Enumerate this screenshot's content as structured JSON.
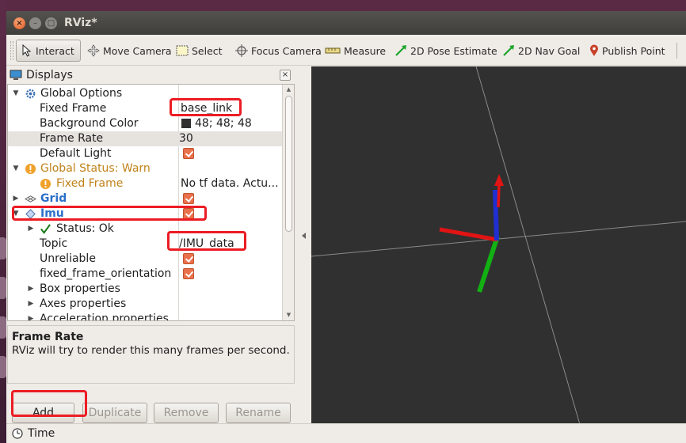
{
  "window": {
    "title": "RViz*"
  },
  "toolbar": {
    "tools": [
      {
        "label": "Interact",
        "icon": "cursor-icon"
      },
      {
        "label": "Move Camera",
        "icon": "move-camera-icon"
      },
      {
        "label": "Select",
        "icon": "select-box-icon"
      },
      {
        "label": "Focus Camera",
        "icon": "focus-crosshair-icon"
      },
      {
        "label": "Measure",
        "icon": "ruler-icon"
      },
      {
        "label": "2D Pose Estimate",
        "icon": "green-arrow-icon"
      },
      {
        "label": "2D Nav Goal",
        "icon": "green-arrow-icon"
      },
      {
        "label": "Publish Point",
        "icon": "map-pin-icon"
      }
    ]
  },
  "displays": {
    "title": "Displays",
    "close_label": "×",
    "rows": [
      {
        "name": "Global Options",
        "value": ""
      },
      {
        "name": "Fixed Frame",
        "value": "base_link"
      },
      {
        "name": "Background Color",
        "value": "48; 48; 48"
      },
      {
        "name": "Frame Rate",
        "value": "30"
      },
      {
        "name": "Default Light",
        "value": ""
      },
      {
        "name": "Global Status: Warn",
        "value": ""
      },
      {
        "name": "Fixed Frame",
        "value": "No tf data.  Actu..."
      },
      {
        "name": "Grid",
        "value": ""
      },
      {
        "name": "Imu",
        "value": ""
      },
      {
        "name": "Status: Ok",
        "value": ""
      },
      {
        "name": "Topic",
        "value": "/IMU_data"
      },
      {
        "name": "Unreliable",
        "value": ""
      },
      {
        "name": "fixed_frame_orientation",
        "value": ""
      },
      {
        "name": "Box properties",
        "value": ""
      },
      {
        "name": "Axes properties",
        "value": ""
      },
      {
        "name": "Acceleration properties",
        "value": ""
      }
    ],
    "description": {
      "title": "Frame Rate",
      "text": "RViz will try to render this many frames per second."
    },
    "buttons": {
      "add": "Add",
      "duplicate": "Duplicate",
      "remove": "Remove",
      "rename": "Rename"
    }
  },
  "colors": {
    "background_swatch": "#303030",
    "checkbox": "#e9704a",
    "annotation": "#ec1c24",
    "warn": "#c0821a",
    "link_blue": "#2a6fc9"
  },
  "timebar": {
    "label": "Time"
  }
}
